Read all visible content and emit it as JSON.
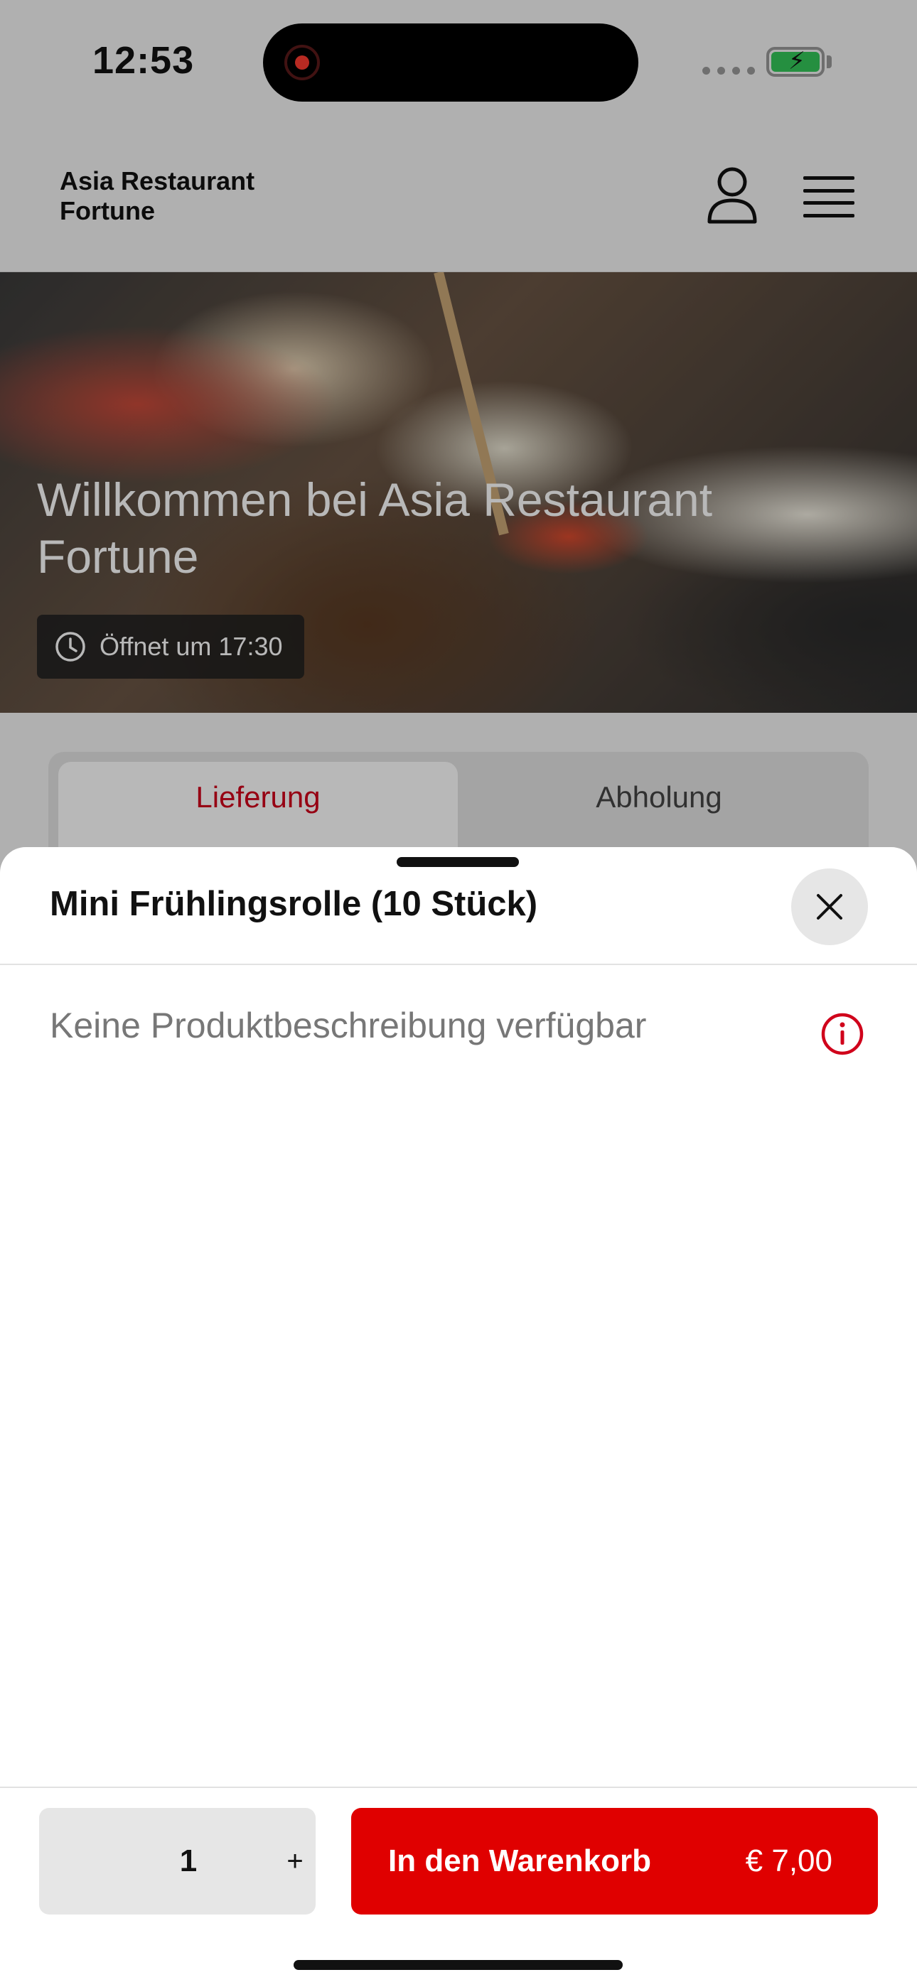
{
  "status_bar": {
    "time": "12:53"
  },
  "header": {
    "brand": "Asia Restaurant\nFortune"
  },
  "hero": {
    "title": "Willkommen bei Asia Restaurant Fortune",
    "opening": "Öffnet um 17:30"
  },
  "order_mode": {
    "tabs": [
      {
        "label": "Lieferung",
        "selected": true
      },
      {
        "label": "Abholung",
        "selected": false
      }
    ]
  },
  "sheet": {
    "title": "Mini Frühlingsrolle (10 Stück)",
    "description": "Keine Produktbeschreibung verfügbar"
  },
  "footer": {
    "quantity": "1",
    "plus_label": "+",
    "add_to_cart_label": "In den Warenkorb",
    "price": "€ 7,00"
  },
  "colors": {
    "accent": "#e00000",
    "selected_tab_text": "#d0021b"
  },
  "icons": [
    "user-icon",
    "menu-icon",
    "clock-icon",
    "close-icon",
    "info-icon",
    "battery-charging-icon",
    "record-icon"
  ]
}
